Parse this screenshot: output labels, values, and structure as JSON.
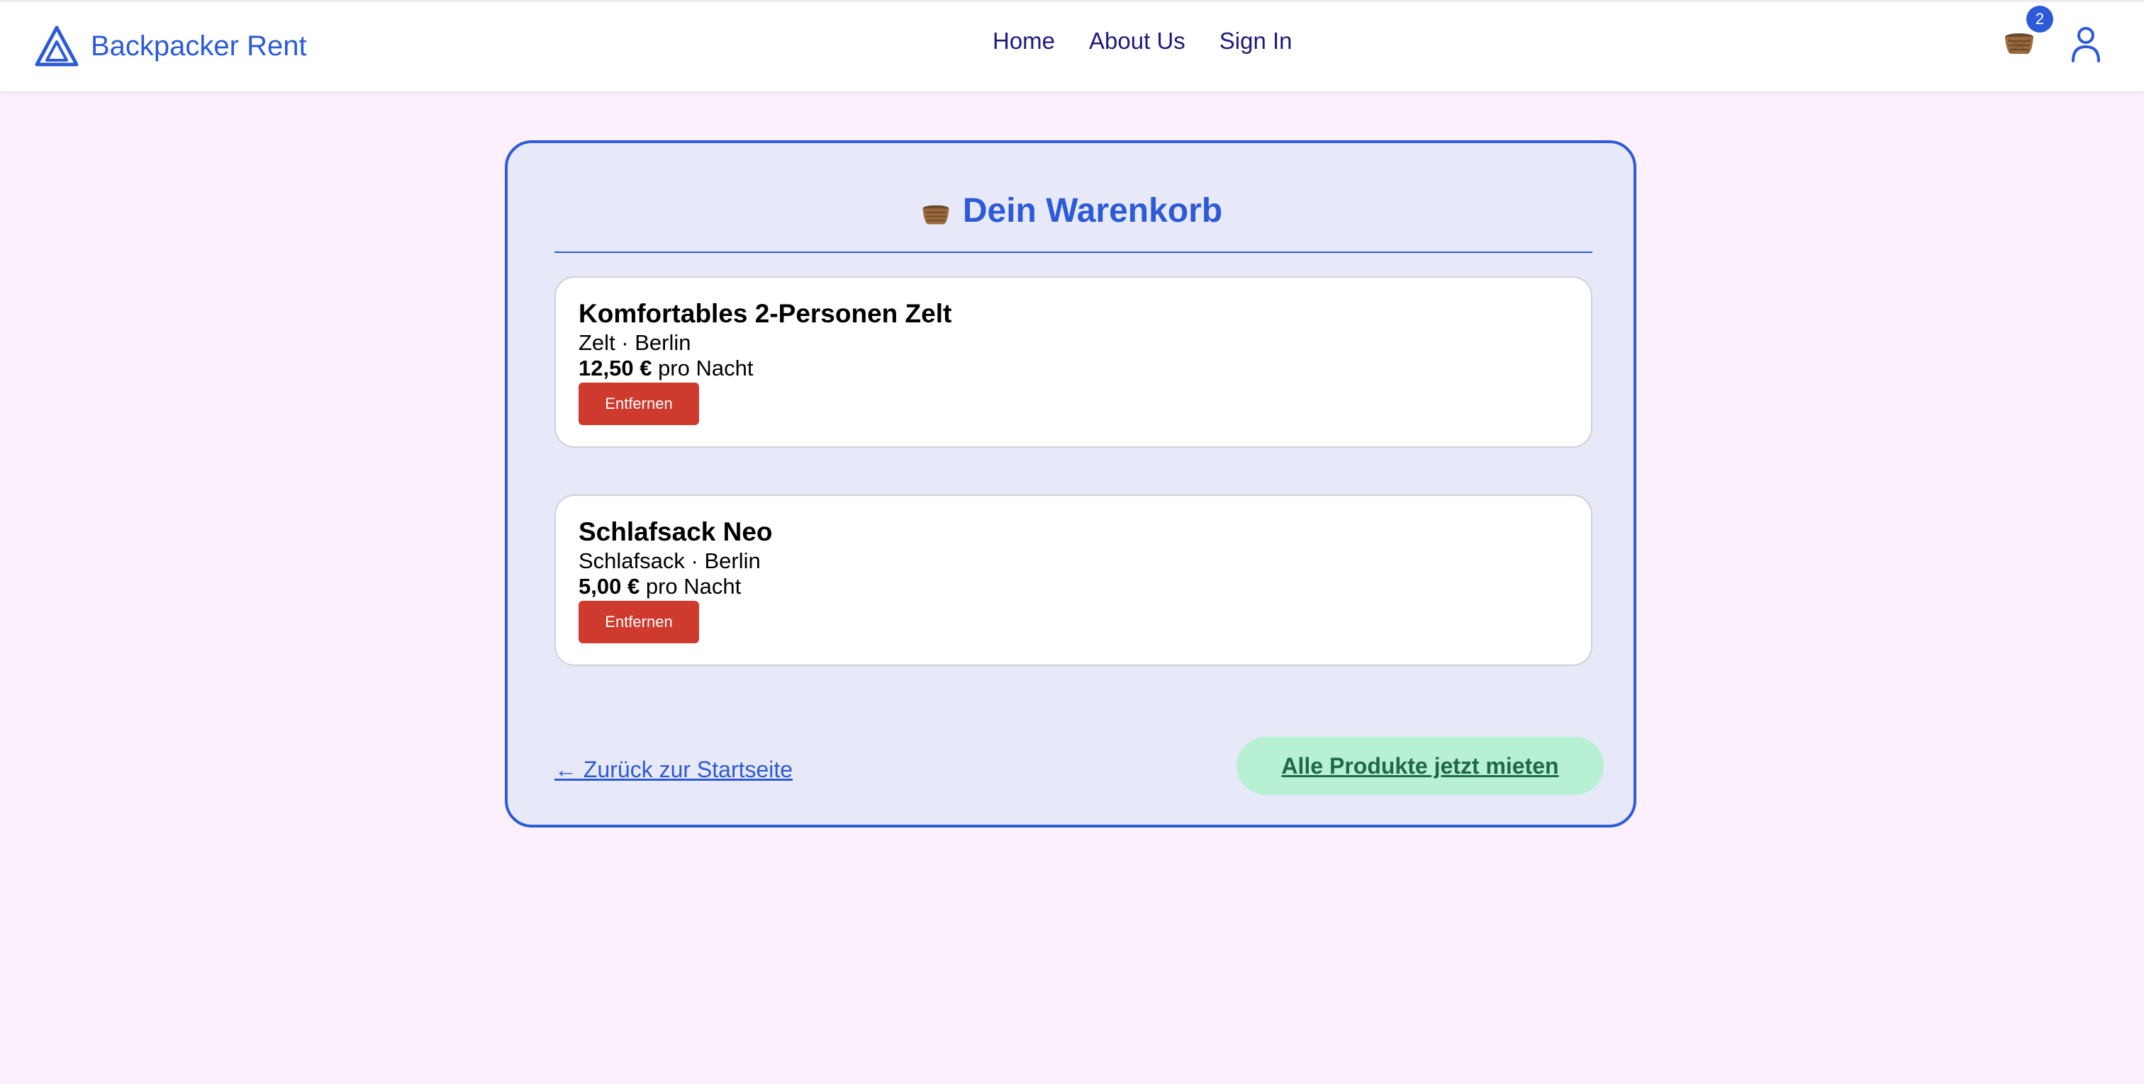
{
  "brand": {
    "name": "Backpacker Rent",
    "logo_icon": "triangle-tent-icon",
    "color": "#2d5bd7"
  },
  "nav": {
    "links": [
      {
        "label": "Home"
      },
      {
        "label": "About Us"
      },
      {
        "label": "Sign In"
      }
    ],
    "link_color": "#1e1a7a"
  },
  "header_actions": {
    "cart_icon": "basket-icon",
    "cart_count": "2",
    "user_icon": "user-icon"
  },
  "cart": {
    "title_icon": "basket-icon",
    "title": "Dein Warenkorb",
    "items": [
      {
        "name": "Komfortables 2-Personen Zelt",
        "meta": "Zelt · Berlin",
        "price": "12,50 €",
        "price_unit": "pro Nacht",
        "remove_label": "Entfernen"
      },
      {
        "name": "Schlafsack Neo",
        "meta": "Schlafsack · Berlin",
        "price": "5,00 €",
        "price_unit": "pro Nacht",
        "remove_label": "Entfernen"
      }
    ],
    "back_link": "← Zurück zur Startseite",
    "rent_all_button": "Alle Produkte jetzt mieten"
  },
  "colors": {
    "page_background": "#fdf0fd",
    "card_background": "#e7e9f8",
    "accent": "#2d5bd7",
    "remove_button": "#cf3a2e",
    "rent_button": "#b8f0d3",
    "rent_button_text": "#1e6a48"
  }
}
